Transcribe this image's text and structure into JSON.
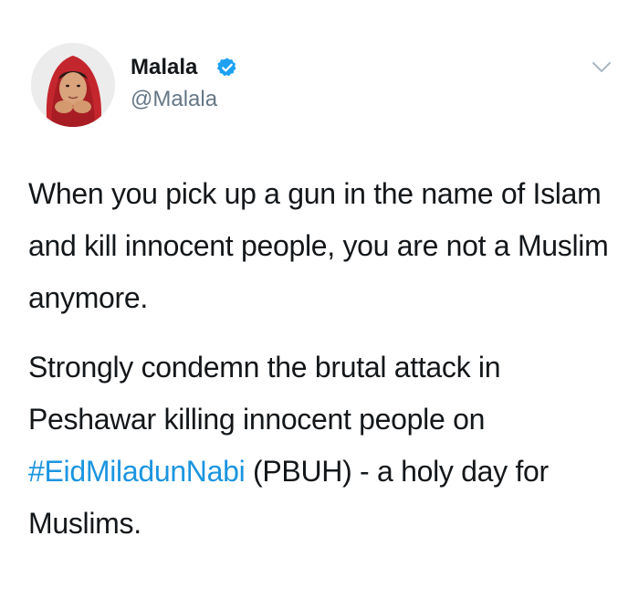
{
  "author": {
    "display_name": "Malala",
    "handle": "@Malala",
    "verified": true
  },
  "tweet": {
    "paragraph_1": "When you pick up a gun in the name of Islam and kill innocent people, you are not a Muslim anymore.",
    "paragraph_2_before": "Strongly condemn the brutal attack in Peshawar killing innocent people on ",
    "hashtag": "#EidMiladunNabi",
    "paragraph_2_after": " (PBUH) - a holy day for Muslims."
  },
  "icons": {
    "verified": "verified-badge-icon",
    "menu": "chevron-down-icon"
  },
  "colors": {
    "text": "#14171a",
    "secondary": "#657786",
    "link": "#1b95e0",
    "verified": "#1da1f2",
    "caret": "#aab8c2"
  }
}
